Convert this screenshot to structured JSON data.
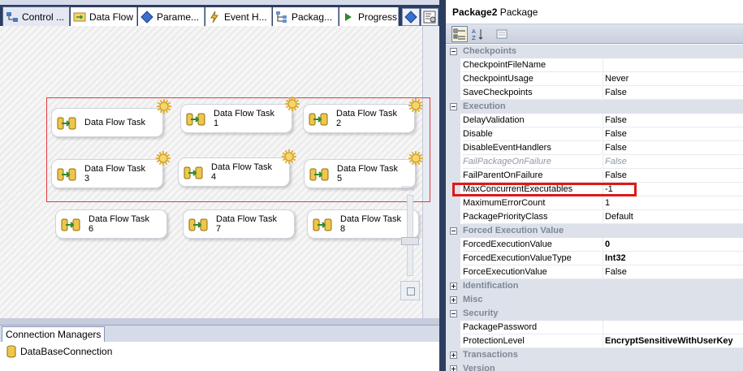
{
  "designer": {
    "tabs": [
      {
        "label": "Control ...",
        "icon": "control-flow-icon"
      },
      {
        "label": "Data Flow",
        "icon": "data-flow-icon"
      },
      {
        "label": "Parame...",
        "icon": "parameters-icon"
      },
      {
        "label": "Event H...",
        "icon": "event-handlers-icon"
      },
      {
        "label": "Packag...",
        "icon": "package-explorer-icon"
      },
      {
        "label": "Progress",
        "icon": "progress-icon"
      }
    ],
    "zoom_label": "80%",
    "tasks": [
      {
        "line1": "Data Flow Task",
        "line2": ""
      },
      {
        "line1": "Data Flow Task",
        "line2": "1"
      },
      {
        "line1": "Data Flow Task",
        "line2": "2"
      },
      {
        "line1": "Data Flow Task",
        "line2": "3"
      },
      {
        "line1": "Data Flow Task",
        "line2": "4"
      },
      {
        "line1": "Data Flow Task",
        "line2": "5"
      },
      {
        "line1": "Data Flow Task",
        "line2": "6"
      },
      {
        "line1": "Data Flow Task",
        "line2": "7"
      },
      {
        "line1": "Data Flow Task",
        "line2": "8"
      }
    ]
  },
  "connections": {
    "tab_label": "Connection Managers",
    "items": [
      "DataBaseConnection"
    ]
  },
  "properties": {
    "object_name": "Package2",
    "object_type": "Package",
    "rows": [
      {
        "type": "cat",
        "name": "Checkpoints",
        "expanded": true
      },
      {
        "name": "CheckpointFileName",
        "value": ""
      },
      {
        "name": "CheckpointUsage",
        "value": "Never"
      },
      {
        "name": "SaveCheckpoints",
        "value": "False"
      },
      {
        "type": "cat",
        "name": "Execution",
        "expanded": true
      },
      {
        "name": "DelayValidation",
        "value": "False"
      },
      {
        "name": "Disable",
        "value": "False"
      },
      {
        "name": "DisableEventHandlers",
        "value": "False"
      },
      {
        "name": "FailPackageOnFailure",
        "value": "False",
        "muted": true
      },
      {
        "name": "FailParentOnFailure",
        "value": "False"
      },
      {
        "name": "MaxConcurrentExecutables",
        "value": "-1",
        "highlighted": true
      },
      {
        "name": "MaximumErrorCount",
        "value": "1"
      },
      {
        "name": "PackagePriorityClass",
        "value": "Default"
      },
      {
        "type": "cat",
        "name": "Forced Execution Value",
        "expanded": true
      },
      {
        "name": "ForcedExecutionValue",
        "value": "0",
        "bold": true
      },
      {
        "name": "ForcedExecutionValueType",
        "value": "Int32",
        "bold": true
      },
      {
        "name": "ForceExecutionValue",
        "value": "False"
      },
      {
        "type": "cat",
        "name": "Identification",
        "expanded": false
      },
      {
        "type": "cat",
        "name": "Misc",
        "expanded": false
      },
      {
        "type": "cat",
        "name": "Security",
        "expanded": true
      },
      {
        "name": "PackagePassword",
        "value": ""
      },
      {
        "name": "ProtectionLevel",
        "value": "EncryptSensitiveWithUserKey",
        "bold": true
      },
      {
        "type": "cat",
        "name": "Transactions",
        "expanded": false
      },
      {
        "type": "cat",
        "name": "Version",
        "expanded": false
      }
    ]
  },
  "colors": {
    "accent_navy": "#2c3e60",
    "selection_red": "#e23a3a",
    "highlight_red": "#e01818",
    "category_bg": "#dde1ea"
  }
}
